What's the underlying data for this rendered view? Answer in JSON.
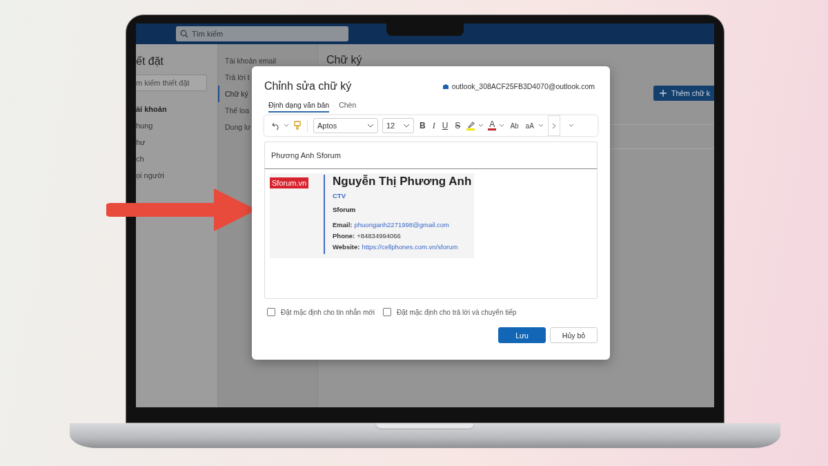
{
  "screen": {
    "search": {
      "placeholder": "Tìm kiếm"
    },
    "settings_nav": {
      "title": "ết đặt",
      "search": {
        "placeholder": "m kiếm thiết đặt"
      },
      "items": [
        {
          "label": "ài khoản",
          "kind": "heading"
        },
        {
          "label": "hung",
          "kind": "item"
        },
        {
          "label": "hư",
          "kind": "item"
        },
        {
          "label": "ch",
          "kind": "item"
        },
        {
          "label": "ọi người",
          "kind": "item"
        }
      ]
    },
    "settings_sub": {
      "items": [
        {
          "label": "Tài khoản email",
          "selected": false
        },
        {
          "label": "Trả lời t",
          "selected": false
        },
        {
          "label": "Chữ ký",
          "selected": true
        },
        {
          "label": "Thể loa",
          "selected": false
        },
        {
          "label": "Dung lư",
          "selected": false
        }
      ]
    },
    "content": {
      "title": "Chữ ký",
      "add_button": "Thêm chữ k"
    }
  },
  "dialog": {
    "title": "Chỉnh sửa chữ ký",
    "account": "outlook_308ACF25FB3D4070@outlook.com",
    "tabs": [
      {
        "label": "Định dạng văn bản",
        "selected": true
      },
      {
        "label": "Chèn",
        "selected": false
      }
    ],
    "toolbar": {
      "font": "Aptos",
      "size": "12",
      "letters": [
        {
          "label": "B",
          "kind": "bold"
        },
        {
          "label": "I",
          "kind": "italic"
        },
        {
          "label": "U",
          "kind": "underline"
        },
        {
          "label": "S",
          "kind": "strike"
        }
      ],
      "font_color": "A",
      "effects": "Ab",
      "case": "aA"
    },
    "signature_name": "Phương Anh Sforum",
    "signature": {
      "logo": "Sforum.vn",
      "name": "Nguyễn Thị Phương Anh",
      "role": "CTV",
      "company": "Sforum",
      "lines": [
        {
          "label": "Email:",
          "value": "phuonganh2271998@gmail.com",
          "link": true
        },
        {
          "label": "Phone:",
          "value": "+84834994066",
          "link": false
        },
        {
          "label": "Website:",
          "value": "https://cellphones.com.vn/sforum",
          "link": true
        }
      ]
    },
    "options": [
      {
        "label": "Đặt mặc định cho tin nhắn mới",
        "checked": false
      },
      {
        "label": "Đặt mặc định cho trả lời và chuyển tiếp",
        "checked": false
      }
    ],
    "buttons": [
      {
        "label": "Lưu",
        "kind": "primary"
      },
      {
        "label": "Hủy bỏ",
        "kind": "secondary"
      }
    ]
  }
}
